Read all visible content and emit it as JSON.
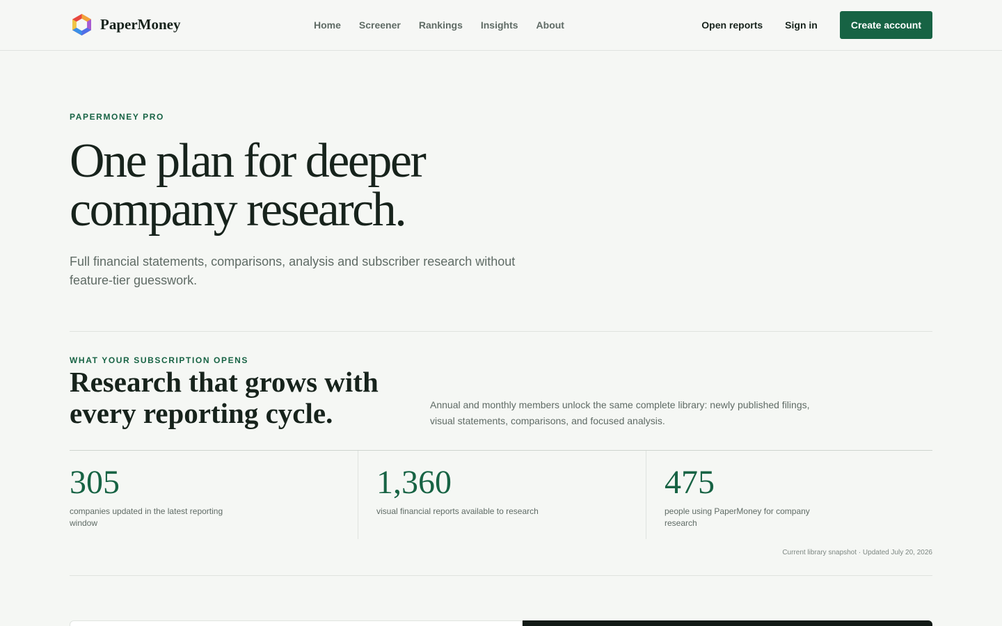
{
  "header": {
    "brand": "PaperMoney",
    "nav": [
      "Home",
      "Screener",
      "Rankings",
      "Insights",
      "About"
    ],
    "open_reports": "Open reports",
    "sign_in": "Sign in",
    "create_account": "Create account"
  },
  "hero": {
    "eyebrow": "PAPERMONEY PRO",
    "title": "One plan for deeper company research.",
    "subtitle": "Full financial statements, comparisons, analysis and subscriber research without feature-tier guesswork."
  },
  "subscription": {
    "eyebrow": "WHAT YOUR SUBSCRIPTION OPENS",
    "title": "Research that grows with every reporting cycle.",
    "description": "Annual and monthly members unlock the same complete library: newly published filings, visual statements, comparisons, and focused analysis.",
    "stats": [
      {
        "value": "305",
        "label": "companies updated in the latest reporting window"
      },
      {
        "value": "1,360",
        "label": "visual financial reports available to research"
      },
      {
        "value": "475",
        "label": "people using PaperMoney for company research"
      }
    ],
    "snapshot": "Current library snapshot · Updated July 20, 2026"
  },
  "colors": {
    "accent": "#176344",
    "background": "#f5f7f4",
    "text": "#17231c",
    "muted": "#5f6b65",
    "dark_panel": "#121a16"
  }
}
